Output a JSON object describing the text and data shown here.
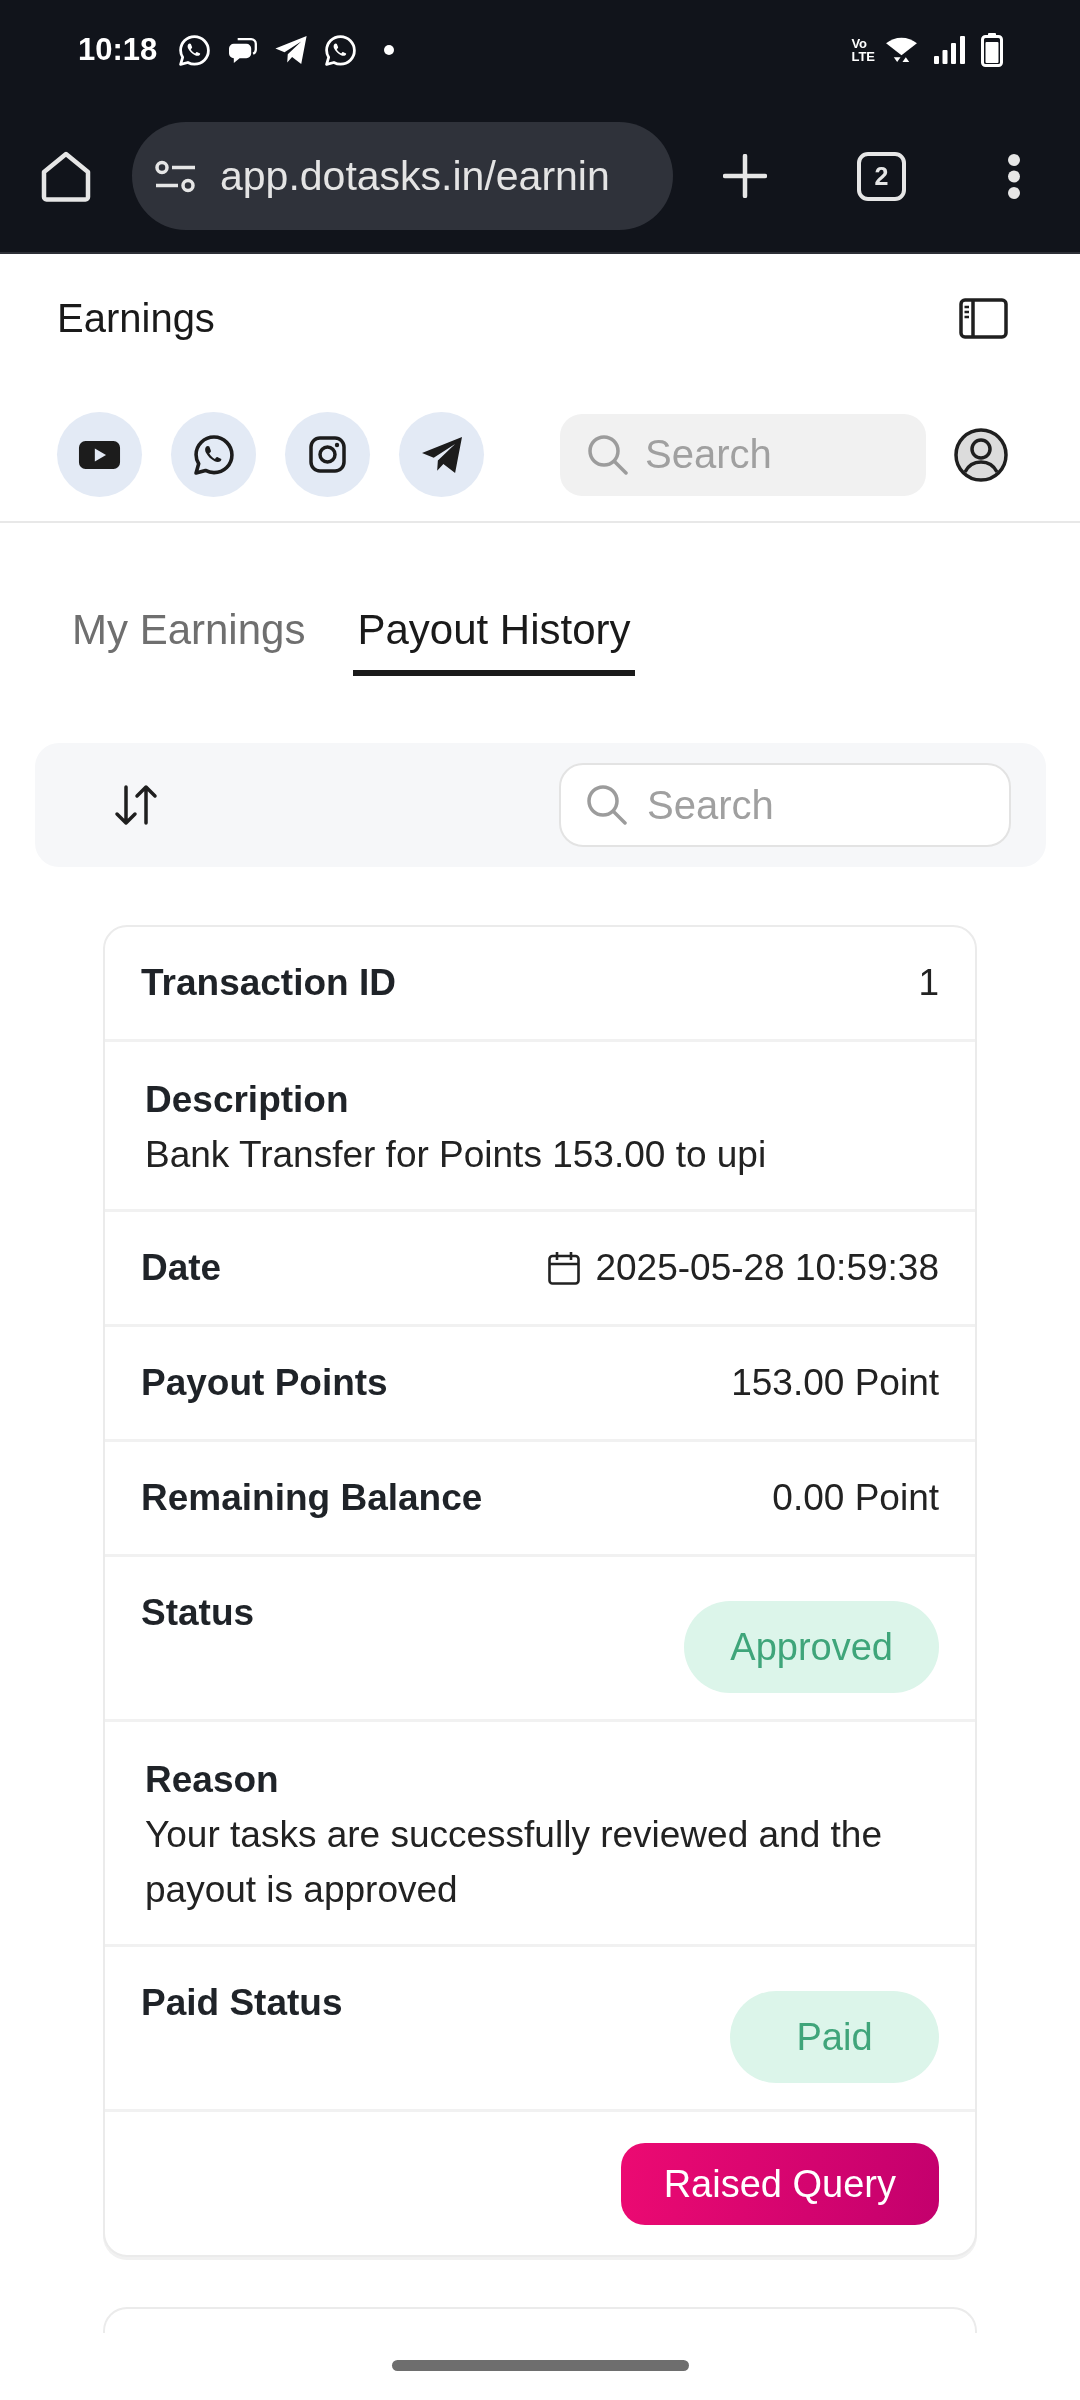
{
  "status_bar": {
    "time": "10:18",
    "network_type": {
      "top": "Vo",
      "bottom": "LTE"
    }
  },
  "browser": {
    "url": "app.dotasks.in/earnin",
    "tab_count": "2"
  },
  "header": {
    "title": "Earnings",
    "search": {
      "placeholder": "Search"
    }
  },
  "tabs": [
    {
      "label": "My Earnings",
      "selected": false
    },
    {
      "label": "Payout History",
      "selected": true
    }
  ],
  "toolbar": {
    "search": {
      "placeholder": "Search"
    }
  },
  "payouts": [
    {
      "fields": [
        {
          "kind": "inline",
          "label": "Transaction ID",
          "value": "1"
        },
        {
          "kind": "stacked",
          "label": "Description",
          "value": "Bank Transfer for Points 153.00 to upi"
        },
        {
          "kind": "date",
          "label": "Date",
          "value": "2025-05-28 10:59:38"
        },
        {
          "kind": "inline",
          "label": "Payout Points",
          "value": "153.00 Point"
        },
        {
          "kind": "inline",
          "label": "Remaining Balance",
          "value": "0.00 Point"
        },
        {
          "kind": "pill",
          "label": "Status",
          "value": "Approved"
        },
        {
          "kind": "stacked",
          "label": "Reason",
          "value": "Your tasks are successfully reviewed and the payout is approved"
        },
        {
          "kind": "pill",
          "label": "Paid Status",
          "value": "Paid"
        }
      ],
      "action": "Raised Query"
    }
  ],
  "more_cards_below": true
}
